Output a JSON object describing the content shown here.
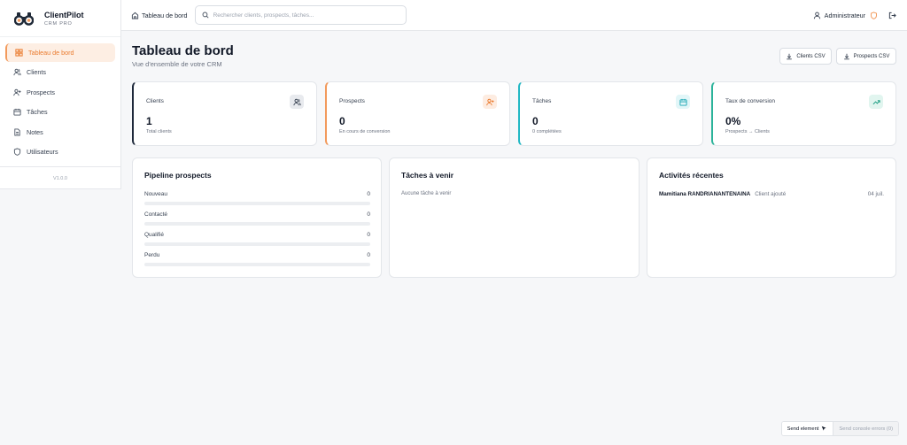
{
  "colors": {
    "accent": "#ea7a2d",
    "clients": "#1e293b",
    "prospects": "#f29a5c",
    "taches": "#22b8c4",
    "conversion": "#2bb39a"
  },
  "brand": {
    "name": "ClientPilot",
    "subtitle": "CRM PRO",
    "icon": "binoculars-logo-icon"
  },
  "sidebar": {
    "items": [
      {
        "label": "Tableau de bord",
        "icon": "dashboard-grid-icon",
        "active": true
      },
      {
        "label": "Clients",
        "icon": "users-icon"
      },
      {
        "label": "Prospects",
        "icon": "user-plus-icon"
      },
      {
        "label": "Tâches",
        "icon": "calendar-icon"
      },
      {
        "label": "Notes",
        "icon": "note-icon"
      },
      {
        "label": "Utilisateurs",
        "icon": "shield-icon"
      }
    ],
    "version": "V1.0.0"
  },
  "topbar": {
    "breadcrumb": "Tableau de bord",
    "search_placeholder": "Rechercher clients, prospects, tâches...",
    "user": "Administrateur"
  },
  "header": {
    "title": "Tableau de bord",
    "subtitle": "Vue d'ensemble de votre CRM",
    "export_clients": "Clients CSV",
    "export_prospects": "Prospects CSV"
  },
  "stats": [
    {
      "label": "Clients",
      "value": "1",
      "desc": "Total clients",
      "icon": "users-icon"
    },
    {
      "label": "Prospects",
      "value": "0",
      "desc": "En cours de conversion",
      "icon": "user-plus-icon"
    },
    {
      "label": "Tâches",
      "value": "0",
      "desc": "0 complétées",
      "icon": "calendar-icon"
    },
    {
      "label": "Taux de conversion",
      "value": "0%",
      "desc": "Prospects → Clients",
      "icon": "trend-up-icon"
    }
  ],
  "pipeline": {
    "title": "Pipeline prospects",
    "stages": [
      {
        "label": "Nouveau",
        "count": "0",
        "fraction": 0
      },
      {
        "label": "Contacté",
        "count": "0",
        "fraction": 0
      },
      {
        "label": "Qualifié",
        "count": "0",
        "fraction": 0
      },
      {
        "label": "Perdu",
        "count": "0",
        "fraction": 0
      }
    ]
  },
  "tasks": {
    "title": "Tâches à venir",
    "empty": "Aucune tâche à venir"
  },
  "activities": {
    "title": "Activités récentes",
    "items": [
      {
        "who": "Mamitiana RANDRIANANTENAINA",
        "what": "Client ajouté",
        "when": "04 juil."
      }
    ]
  },
  "debug": {
    "send_element": "Send element",
    "send_console": "Send console errors (0)"
  }
}
